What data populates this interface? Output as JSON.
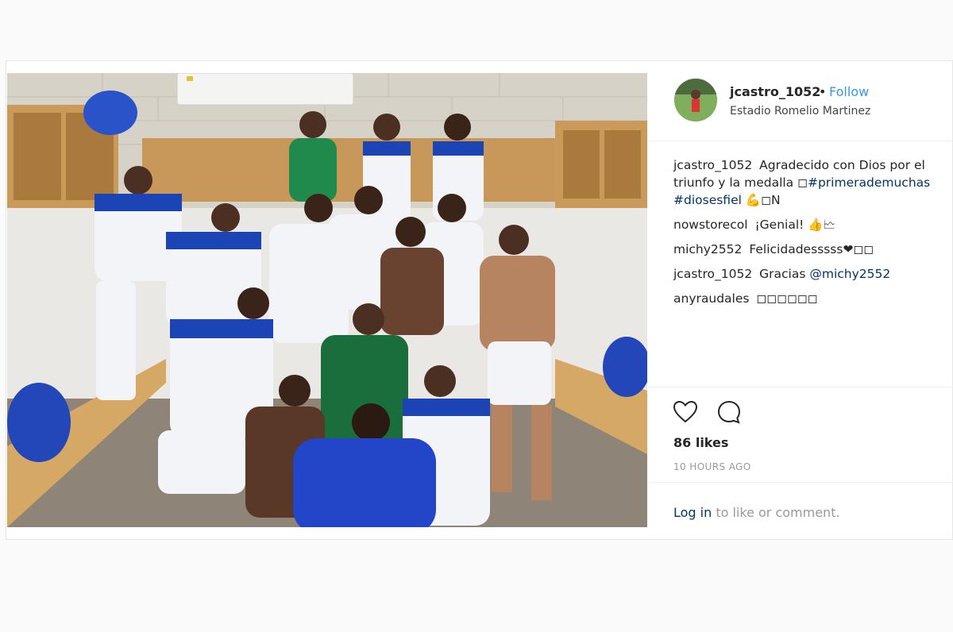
{
  "post": {
    "username": "jcastro_1052",
    "separator": "•",
    "follow_label": "Follow",
    "location": "Estadio Romelio Martinez",
    "comments": [
      {
        "user": "jcastro_1052",
        "text": "Agradecido con Dios por el triunfo y la medalla ◻",
        "tag1": "#primerademuchas",
        "tag2": "#diosesfiel",
        "tail": " 💪◻N"
      },
      {
        "user": "nowstorecol",
        "text": "¡Genial! 👍🗠"
      },
      {
        "user": "michy2552",
        "text": "Felicidadesssss❤◻◻"
      },
      {
        "user": "jcastro_1052",
        "text": "Gracias",
        "mention": "@michy2552"
      },
      {
        "user": "anyraudales",
        "text": "◻◻◻◻◻◻"
      }
    ],
    "likes": "86 likes",
    "time_ago": "10 HOURS AGO",
    "login_link": "Log in",
    "login_rest": " to like or comment."
  },
  "icons": {
    "like": "heart-icon",
    "comment": "comment-bubble-icon"
  },
  "colors": {
    "link_blue": "#3897f0",
    "tag_blue": "#003569",
    "kit_blue": "#1c44b5",
    "gk_green": "#1f8a4c"
  }
}
